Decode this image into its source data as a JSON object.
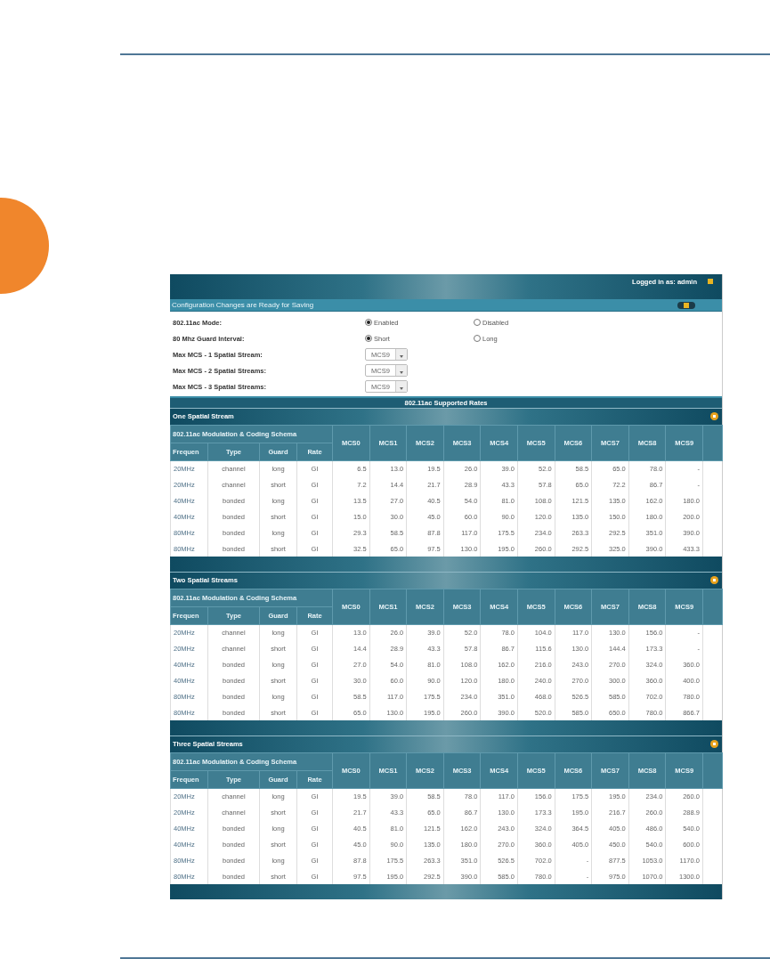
{
  "header": {
    "login": "Logged in as: admin"
  },
  "notice": {
    "text": "Configuration Changes are Ready for Saving"
  },
  "form": {
    "rows": [
      {
        "kind": "radio",
        "label": "802.11ac Mode:",
        "options": [
          {
            "label": "Enabled",
            "selected": true
          },
          {
            "label": "Disabled",
            "selected": false
          }
        ]
      },
      {
        "kind": "radio",
        "label": "80 Mhz Guard Interval:",
        "options": [
          {
            "label": "Short",
            "selected": true
          },
          {
            "label": "Long",
            "selected": false
          }
        ]
      },
      {
        "kind": "select",
        "label": "Max MCS - 1 Spatial Stream:",
        "value": "MCS9"
      },
      {
        "kind": "select",
        "label": "Max MCS - 2 Spatial Streams:",
        "value": "MCS9"
      },
      {
        "kind": "select",
        "label": "Max MCS - 3 Spatial Streams:",
        "value": "MCS9"
      }
    ]
  },
  "rates_title": "802.11ac Supported Rates",
  "sections": [
    {
      "title": "One Spatial Stream",
      "group_header": "802.11ac Modulation & Coding Schema",
      "columns": [
        "Frequen",
        "Type",
        "Guard",
        "Rate"
      ],
      "mcs_columns": [
        "MCS0",
        "MCS1",
        "MCS2",
        "MCS3",
        "MCS4",
        "MCS5",
        "MCS6",
        "MCS7",
        "MCS8",
        "MCS9"
      ],
      "rows": [
        {
          "frequency": "20MHz",
          "type": "channel",
          "guard": "long",
          "rate": "GI",
          "values": [
            "6.5",
            "13.0",
            "19.5",
            "26.0",
            "39.0",
            "52.0",
            "58.5",
            "65.0",
            "78.0",
            "-"
          ]
        },
        {
          "frequency": "20MHz",
          "type": "channel",
          "guard": "short",
          "rate": "GI",
          "values": [
            "7.2",
            "14.4",
            "21.7",
            "28.9",
            "43.3",
            "57.8",
            "65.0",
            "72.2",
            "86.7",
            "-"
          ]
        },
        {
          "frequency": "40MHz",
          "type": "bonded",
          "guard": "long",
          "rate": "GI",
          "values": [
            "13.5",
            "27.0",
            "40.5",
            "54.0",
            "81.0",
            "108.0",
            "121.5",
            "135.0",
            "162.0",
            "180.0"
          ]
        },
        {
          "frequency": "40MHz",
          "type": "bonded",
          "guard": "short",
          "rate": "GI",
          "values": [
            "15.0",
            "30.0",
            "45.0",
            "60.0",
            "90.0",
            "120.0",
            "135.0",
            "150.0",
            "180.0",
            "200.0"
          ]
        },
        {
          "frequency": "80MHz",
          "type": "bonded",
          "guard": "long",
          "rate": "GI",
          "values": [
            "29.3",
            "58.5",
            "87.8",
            "117.0",
            "175.5",
            "234.0",
            "263.3",
            "292.5",
            "351.0",
            "390.0"
          ]
        },
        {
          "frequency": "80MHz",
          "type": "bonded",
          "guard": "short",
          "rate": "GI",
          "values": [
            "32.5",
            "65.0",
            "97.5",
            "130.0",
            "195.0",
            "260.0",
            "292.5",
            "325.0",
            "390.0",
            "433.3"
          ]
        }
      ]
    },
    {
      "title": "Two Spatial Streams",
      "group_header": "802.11ac Modulation & Coding Schema",
      "columns": [
        "Frequen",
        "Type",
        "Guard",
        "Rate"
      ],
      "mcs_columns": [
        "MCS0",
        "MCS1",
        "MCS2",
        "MCS3",
        "MCS4",
        "MCS5",
        "MCS6",
        "MCS7",
        "MCS8",
        "MCS9"
      ],
      "rows": [
        {
          "frequency": "20MHz",
          "type": "channel",
          "guard": "long",
          "rate": "GI",
          "values": [
            "13.0",
            "26.0",
            "39.0",
            "52.0",
            "78.0",
            "104.0",
            "117.0",
            "130.0",
            "156.0",
            "-"
          ]
        },
        {
          "frequency": "20MHz",
          "type": "channel",
          "guard": "short",
          "rate": "GI",
          "values": [
            "14.4",
            "28.9",
            "43.3",
            "57.8",
            "86.7",
            "115.6",
            "130.0",
            "144.4",
            "173.3",
            "-"
          ]
        },
        {
          "frequency": "40MHz",
          "type": "bonded",
          "guard": "long",
          "rate": "GI",
          "values": [
            "27.0",
            "54.0",
            "81.0",
            "108.0",
            "162.0",
            "216.0",
            "243.0",
            "270.0",
            "324.0",
            "360.0"
          ]
        },
        {
          "frequency": "40MHz",
          "type": "bonded",
          "guard": "short",
          "rate": "GI",
          "values": [
            "30.0",
            "60.0",
            "90.0",
            "120.0",
            "180.0",
            "240.0",
            "270.0",
            "300.0",
            "360.0",
            "400.0"
          ]
        },
        {
          "frequency": "80MHz",
          "type": "bonded",
          "guard": "long",
          "rate": "GI",
          "values": [
            "58.5",
            "117.0",
            "175.5",
            "234.0",
            "351.0",
            "468.0",
            "526.5",
            "585.0",
            "702.0",
            "780.0"
          ]
        },
        {
          "frequency": "80MHz",
          "type": "bonded",
          "guard": "short",
          "rate": "GI",
          "values": [
            "65.0",
            "130.0",
            "195.0",
            "260.0",
            "390.0",
            "520.0",
            "585.0",
            "650.0",
            "780.0",
            "866.7"
          ]
        }
      ]
    },
    {
      "title": "Three Spatial Streams",
      "group_header": "802.11ac Modulation & Coding Schema",
      "columns": [
        "Frequen",
        "Type",
        "Guard",
        "Rate"
      ],
      "mcs_columns": [
        "MCS0",
        "MCS1",
        "MCS2",
        "MCS3",
        "MCS4",
        "MCS5",
        "MCS6",
        "MCS7",
        "MCS8",
        "MCS9"
      ],
      "rows": [
        {
          "frequency": "20MHz",
          "type": "channel",
          "guard": "long",
          "rate": "GI",
          "values": [
            "19.5",
            "39.0",
            "58.5",
            "78.0",
            "117.0",
            "156.0",
            "175.5",
            "195.0",
            "234.0",
            "260.0"
          ]
        },
        {
          "frequency": "20MHz",
          "type": "channel",
          "guard": "short",
          "rate": "GI",
          "values": [
            "21.7",
            "43.3",
            "65.0",
            "86.7",
            "130.0",
            "173.3",
            "195.0",
            "216.7",
            "260.0",
            "288.9"
          ]
        },
        {
          "frequency": "40MHz",
          "type": "bonded",
          "guard": "long",
          "rate": "GI",
          "values": [
            "40.5",
            "81.0",
            "121.5",
            "162.0",
            "243.0",
            "324.0",
            "364.5",
            "405.0",
            "486.0",
            "540.0"
          ]
        },
        {
          "frequency": "40MHz",
          "type": "bonded",
          "guard": "short",
          "rate": "GI",
          "values": [
            "45.0",
            "90.0",
            "135.0",
            "180.0",
            "270.0",
            "360.0",
            "405.0",
            "450.0",
            "540.0",
            "600.0"
          ]
        },
        {
          "frequency": "80MHz",
          "type": "bonded",
          "guard": "long",
          "rate": "GI",
          "values": [
            "87.8",
            "175.5",
            "263.3",
            "351.0",
            "526.5",
            "702.0",
            "-",
            "877.5",
            "1053.0",
            "1170.0"
          ]
        },
        {
          "frequency": "80MHz",
          "type": "bonded",
          "guard": "short",
          "rate": "GI",
          "values": [
            "97.5",
            "195.0",
            "292.5",
            "390.0",
            "585.0",
            "780.0",
            "-",
            "975.0",
            "1070.0",
            "1300.0"
          ]
        }
      ]
    }
  ]
}
